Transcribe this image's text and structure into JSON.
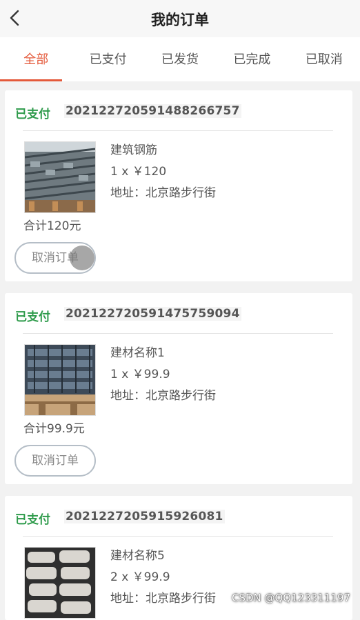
{
  "header": {
    "title": "我的订单",
    "back_icon": "chevron-left-icon"
  },
  "tabs": [
    {
      "label": "全部",
      "active": true
    },
    {
      "label": "已支付",
      "active": false
    },
    {
      "label": "已发货",
      "active": false
    },
    {
      "label": "已完成",
      "active": false
    },
    {
      "label": "已取消",
      "active": false
    }
  ],
  "orders": [
    {
      "status": "已支付",
      "order_no": "20212272059148826675​7",
      "product": "建筑钢筋",
      "qty_price": "1 x ￥120",
      "address": "地址：北京路步行街",
      "total": "合计120元",
      "cancel_label": "取消订单"
    },
    {
      "status": "已支付",
      "order_no": "20212272059147575909​4",
      "product": "建材名称1",
      "qty_price": "1 x ￥99.9",
      "address": "地址：北京路步行街",
      "total": "合计99.9元",
      "cancel_label": "取消订单"
    },
    {
      "status": "已支付",
      "order_no": "2021227205915926081",
      "product": "建材名称5",
      "qty_price": "2 x ￥99.9",
      "address": "地址：北京路步行街",
      "total": "",
      "cancel_label": ""
    }
  ],
  "watermark": "CSDN @QQ123311197",
  "colors": {
    "accent": "#e4593a",
    "status_paid": "#2e9b4b"
  }
}
